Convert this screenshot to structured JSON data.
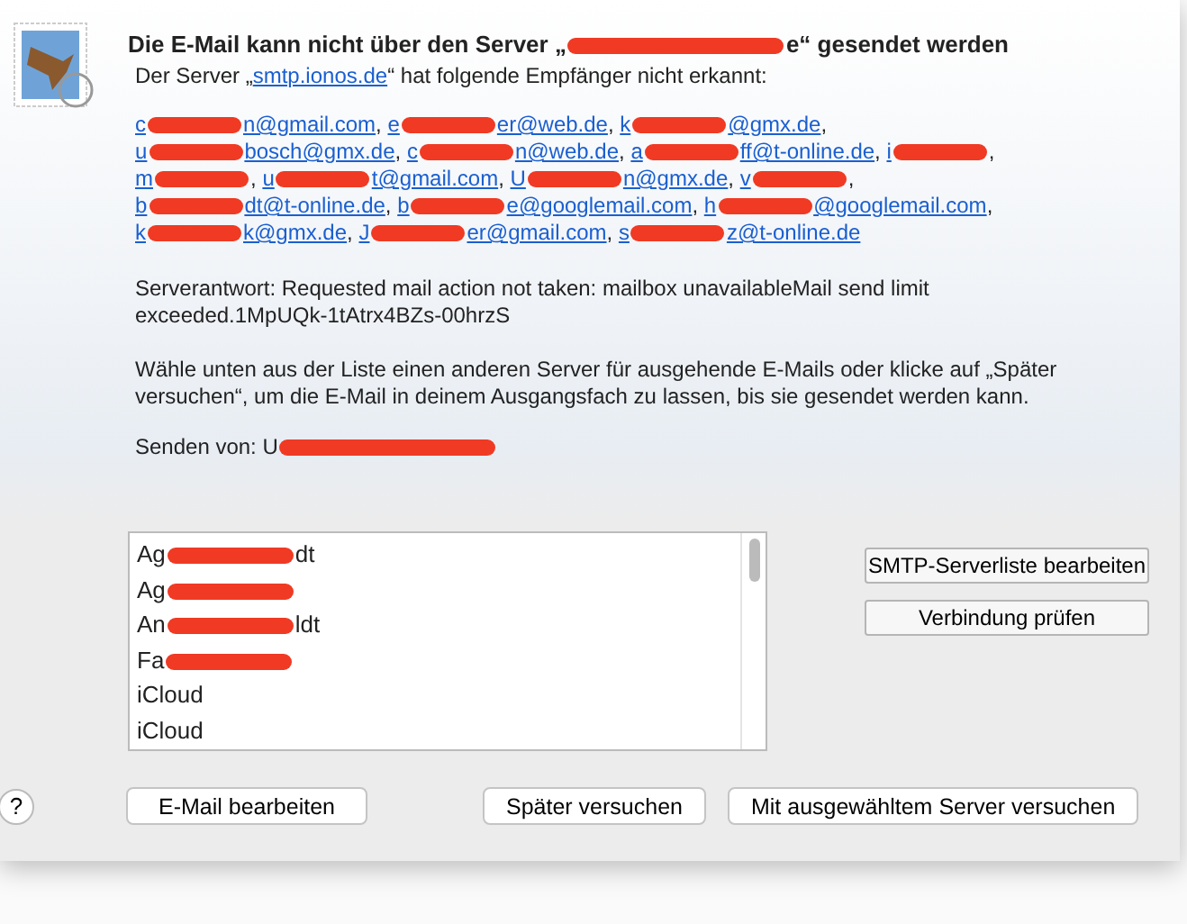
{
  "dialog": {
    "title": {
      "before": "Die E-Mail kann nicht über den Server „",
      "redacted": true,
      "after": "e“ gesendet werden"
    },
    "server_line": {
      "before": "Der Server „",
      "server": "smtp.ionos.de",
      "after": "“ hat folgende Empfänger nicht erkannt:"
    },
    "recipients": [
      {
        "prefix": "c",
        "redacted": true,
        "suffix": "n@gmail.com",
        "sep": ","
      },
      {
        "prefix": "e",
        "redacted": true,
        "suffix": "er@web.de",
        "sep": ","
      },
      {
        "prefix": "k",
        "redacted": true,
        "suffix": "@gmx.de",
        "sep": ","
      },
      {
        "prefix": "u",
        "redacted": true,
        "suffix": "bosch@gmx.de",
        "sep": ","
      },
      {
        "prefix": "c",
        "redacted": true,
        "suffix": "n@web.de",
        "sep": ","
      },
      {
        "prefix": "a",
        "redacted": true,
        "suffix": "ff@t-online.de",
        "sep": ","
      },
      {
        "prefix": "i",
        "redacted": true,
        "sep": ","
      },
      {
        "prefix": "m",
        "redacted": true,
        "sep": ","
      },
      {
        "prefix": "u",
        "redacted": true,
        "suffix": "t@gmail.com",
        "sep": ","
      },
      {
        "prefix": "U",
        "redacted": true,
        "suffix": "n@gmx.de",
        "sep": ","
      },
      {
        "prefix": "v",
        "redacted": true,
        "sep": ","
      },
      {
        "prefix": "b",
        "redacted": true,
        "suffix": "dt@t-online.de",
        "sep": ","
      },
      {
        "prefix": "b",
        "redacted": true,
        "suffix": "e@googlemail.com",
        "sep": ","
      },
      {
        "prefix": "h",
        "redacted": true,
        "suffix": "@googlemail.com",
        "sep": ","
      },
      {
        "prefix": "k",
        "redacted": true,
        "suffix": "k@gmx.de",
        "sep": ","
      },
      {
        "prefix": "J",
        "redacted": true,
        "suffix": "er@gmail.com",
        "sep": ","
      },
      {
        "prefix": "s",
        "redacted": true,
        "suffix": "z@t-online.de"
      }
    ],
    "server_response": "Serverantwort: Requested mail action not taken: mailbox unavailableMail send limit exceeded.1MpUQk-1tAtrx4BZs-00hrzS",
    "instructions": "Wähle unten aus der Liste einen anderen Server für ausgehende E-Mails oder klicke auf „Später versuchen“, um die E-Mail in deinem Ausgangsfach zu lassen, bis sie gesendet werden kann.",
    "sender": {
      "label": "Senden von: U",
      "redacted": true
    },
    "servers": [
      {
        "prefix": "Ag",
        "redacted": true,
        "suffix": "dt",
        "selected": false
      },
      {
        "prefix": "Ag",
        "redacted": true,
        "selected": false
      },
      {
        "prefix": "An",
        "redacted": true,
        "suffix": "ldt",
        "selected": false
      },
      {
        "prefix": "Fa",
        "redacted": true,
        "selected": false
      },
      {
        "prefix": "iCloud",
        "redacted": false,
        "selected": false
      },
      {
        "prefix": "iCloud",
        "redacted": false,
        "selected": false
      }
    ],
    "side_buttons": [
      "SMTP-Serverliste bearbeiten",
      "Verbindung prüfen"
    ],
    "help_button": "?",
    "buttons": [
      "E-Mail bearbeiten",
      "Später versuchen",
      "Mit ausgewähltem Server versuchen"
    ]
  }
}
